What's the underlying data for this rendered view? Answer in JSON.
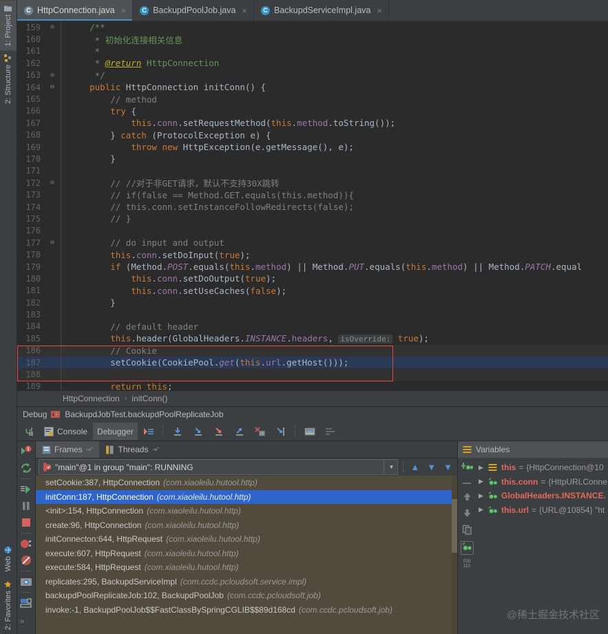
{
  "left_strip": {
    "top_items": [
      {
        "label": "1: Project",
        "icon": "project-icon",
        "active": true
      },
      {
        "label": "2: Structure",
        "icon": "structure-icon",
        "active": false
      }
    ],
    "bottom_items": [
      {
        "label": "Web",
        "icon": "web-icon",
        "active": false
      },
      {
        "label": "2: Favorites",
        "icon": "favorites-star-icon",
        "active": false
      }
    ]
  },
  "editor_tabs": [
    {
      "label": "HttpConnection.java",
      "icon": "java-class-icon",
      "active": true,
      "close": "×"
    },
    {
      "label": "BackupdPoolJob.java",
      "icon": "java-class-icon",
      "active": false,
      "close": "×"
    },
    {
      "label": "BackupdServiceImpl.java",
      "icon": "java-class-icon",
      "active": false,
      "close": "×"
    }
  ],
  "code": {
    "first_line": 159,
    "lines": [
      {
        "n": 159,
        "fold": "⊖",
        "html": "    <span class='cmt'>/**</span>"
      },
      {
        "n": 160,
        "fold": "",
        "html": "     <span class='cmt'>* 初始化连接相关信息</span>"
      },
      {
        "n": 161,
        "fold": "",
        "html": "     <span class='cmt'>*</span>"
      },
      {
        "n": 162,
        "fold": "",
        "html": "     <span class='cmt'>* </span><span class='anno'>@return</span><span class='cmt'> HttpConnection</span>"
      },
      {
        "n": 163,
        "fold": "⊖",
        "html": "     <span class='cmt'>*/</span>"
      },
      {
        "n": 164,
        "fold": "⊖",
        "html": "    <span class='kw'>public</span> HttpConnection <span class='typ'>initConn</span>() {"
      },
      {
        "n": 165,
        "fold": "",
        "html": "        <span class='cmt2'>// method</span>"
      },
      {
        "n": 166,
        "fold": "",
        "html": "        <span class='kw'>try</span> {"
      },
      {
        "n": 167,
        "fold": "",
        "html": "            <span class='kw'>this</span>.<span class='fld'>conn</span>.setRequestMethod(<span class='kw'>this</span>.<span class='fld'>method</span>.toString());"
      },
      {
        "n": 168,
        "fold": "",
        "html": "        } <span class='kw'>catch</span> (ProtocolException e) {"
      },
      {
        "n": 169,
        "fold": "",
        "html": "            <span class='kw'>throw new</span> HttpException(e.getMessage(), e);"
      },
      {
        "n": 170,
        "fold": "",
        "html": "        }"
      },
      {
        "n": 171,
        "fold": "",
        "html": ""
      },
      {
        "n": 172,
        "fold": "⊖",
        "html": "        <span class='cmt2'>// //对于非GET请求，默认不支持30X跳转</span>"
      },
      {
        "n": 173,
        "fold": "",
        "html": "        <span class='cmt2'>// if(false == Method.GET.equals(this.method)){</span>"
      },
      {
        "n": 174,
        "fold": "",
        "html": "        <span class='cmt2'>// this.conn.setInstanceFollowRedirects(false);</span>"
      },
      {
        "n": 175,
        "fold": "",
        "html": "        <span class='cmt2'>// }</span>"
      },
      {
        "n": 176,
        "fold": "",
        "html": ""
      },
      {
        "n": 177,
        "fold": "⊖",
        "html": "        <span class='cmt2'>// do input and output</span>"
      },
      {
        "n": 178,
        "fold": "",
        "html": "        <span class='kw'>this</span>.<span class='fld'>conn</span>.setDoInput(<span class='kw'>true</span>);"
      },
      {
        "n": 179,
        "fold": "",
        "html": "        <span class='kw'>if</span> (Method.<span class='stat'>POST</span>.equals(<span class='kw'>this</span>.<span class='fld'>method</span>) || Method.<span class='stat'>PUT</span>.equals(<span class='kw'>this</span>.<span class='fld'>method</span>) || Method.<span class='stat'>PATCH</span>.equal"
      },
      {
        "n": 180,
        "fold": "",
        "html": "            <span class='kw'>this</span>.<span class='fld'>conn</span>.setDoOutput(<span class='kw'>true</span>);"
      },
      {
        "n": 181,
        "fold": "",
        "html": "            <span class='kw'>this</span>.<span class='fld'>conn</span>.setUseCaches(<span class='kw'>false</span>);"
      },
      {
        "n": 182,
        "fold": "",
        "html": "        }"
      },
      {
        "n": 183,
        "fold": "",
        "html": ""
      },
      {
        "n": 184,
        "fold": "",
        "html": "        <span class='cmt2'>// default header</span>"
      },
      {
        "n": 185,
        "fold": "",
        "html": "        <span class='kw'>this</span>.header(GlobalHeaders.<span class='stat'>INSTANCE</span>.<span class='fld'>headers</span>, <span class='hint'>isOverride:</span> <span class='kw'>true</span>);"
      },
      {
        "n": 186,
        "fold": "",
        "html": "        <span class='cmt2'>// Cookie</span>",
        "hl": true
      },
      {
        "n": 187,
        "fold": "",
        "html": "        setCookie(CookiePool.<span class='stat'>get</span>(<span class='kw'>this</span>.<span class='fld'>url</span>.getHost()));",
        "exec": true
      },
      {
        "n": 188,
        "fold": "",
        "html": "",
        "hl": true
      },
      {
        "n": 189,
        "fold": "",
        "html": "        <span class='kw'>return this</span>;"
      }
    ]
  },
  "breadcrumb": {
    "class_name": "HttpConnection",
    "separator": "›",
    "method_name": "initConn()"
  },
  "debug": {
    "title": "Debug",
    "config_name": "BackupdJobTest.backupdPoolReplicateJob",
    "toolbar": {
      "rerun_icon": "rerun-icon",
      "console_label": "Console",
      "debugger_label": "Debugger",
      "buttons": [
        "show-execution-point-icon",
        "step-over-icon",
        "step-into-icon",
        "force-step-into-icon",
        "step-out-icon",
        "drop-frame-icon",
        "run-to-cursor-icon",
        "evaluate-expression-icon",
        "mute-breakpoints-icon"
      ]
    },
    "rail_icons": [
      "breakpoint-alert-icon",
      "rerun-green-icon",
      "resume-program-icon",
      "pause-program-icon",
      "stop-icon",
      "view-breakpoints-icon",
      "mute-breakpoints-icon",
      "settings-camera-icon",
      "layout-settings-icon",
      "more-chevrons-icon"
    ],
    "panel_tabs": [
      {
        "label": "Frames",
        "icon": "frames-icon",
        "active": true,
        "pin": "⇥ʺ"
      },
      {
        "label": "Threads",
        "icon": "threads-icon",
        "active": false,
        "pin": "⇥ʺ"
      }
    ],
    "thread_selector": {
      "icon": "thread-running-icon",
      "value": "\"main\"@1 in group \"main\": RUNNING",
      "dropdown_arrow": "▼"
    },
    "thread_nav": [
      "up-arrow-icon",
      "down-arrow-icon",
      "filter-icon"
    ],
    "frames": [
      {
        "method": "setCookie:387, HttpConnection",
        "pkg": "(com.xiaoleilu.hutool.http)",
        "selected": false
      },
      {
        "method": "initConn:187, HttpConnection",
        "pkg": "(com.xiaoleilu.hutool.http)",
        "selected": true
      },
      {
        "method": "<init>:154, HttpConnection",
        "pkg": "(com.xiaoleilu.hutool.http)",
        "selected": false
      },
      {
        "method": "create:96, HttpConnection",
        "pkg": "(com.xiaoleilu.hutool.http)",
        "selected": false
      },
      {
        "method": "initConnecton:644, HttpRequest",
        "pkg": "(com.xiaoleilu.hutool.http)",
        "selected": false
      },
      {
        "method": "execute:607, HttpRequest",
        "pkg": "(com.xiaoleilu.hutool.http)",
        "selected": false
      },
      {
        "method": "execute:584, HttpRequest",
        "pkg": "(com.xiaoleilu.hutool.http)",
        "selected": false
      },
      {
        "method": "replicates:295, BackupdServiceImpl",
        "pkg": "(com.ccdc.pcloudsoft.service.impl)",
        "selected": false
      },
      {
        "method": "backupdPoolReplicateJob:102, BackupdPoolJob",
        "pkg": "(com.ccdc.pcloudsoft.job)",
        "selected": false
      },
      {
        "method": "invoke:-1, BackupdPoolJob$$FastClassBySpringCGLIB$$89d168cd",
        "pkg": "(com.ccdc.pcloudsoft.job)",
        "selected": false
      }
    ]
  },
  "variables": {
    "title": "Variables",
    "rail_icons": [
      "add-watch-icon",
      "remove-icon",
      "up-arrow-icon",
      "down-arrow-icon",
      "copy-icon",
      "inspect-icon",
      "binary-icon"
    ],
    "rows": [
      {
        "caret": "▶",
        "icon": "object-icon",
        "name": "this",
        "eq": "=",
        "value": "{HttpConnection@10"
      },
      {
        "caret": "▶",
        "icon": "field-icon",
        "name": "this.conn",
        "eq": "=",
        "value": "{HttpURLConne"
      },
      {
        "caret": "▶",
        "icon": "field-icon",
        "name": "GlobalHeaders.INSTANCE.",
        "eq": "",
        "value": ""
      },
      {
        "caret": "▶",
        "icon": "field-icon",
        "name": "this.url",
        "eq": "=",
        "value": "{URL@10854} \"ht"
      }
    ]
  },
  "watermark": "@稀土掘金技术社区",
  "colors": {
    "editor_bg": "#2b2b2b",
    "chrome_bg": "#3c3f41",
    "accent_blue": "#4a88c7",
    "selection_blue": "#2f65ca",
    "exec_line": "#2a3a54",
    "frames_bg": "#514b3d",
    "annotation_red": "#e8493a"
  }
}
